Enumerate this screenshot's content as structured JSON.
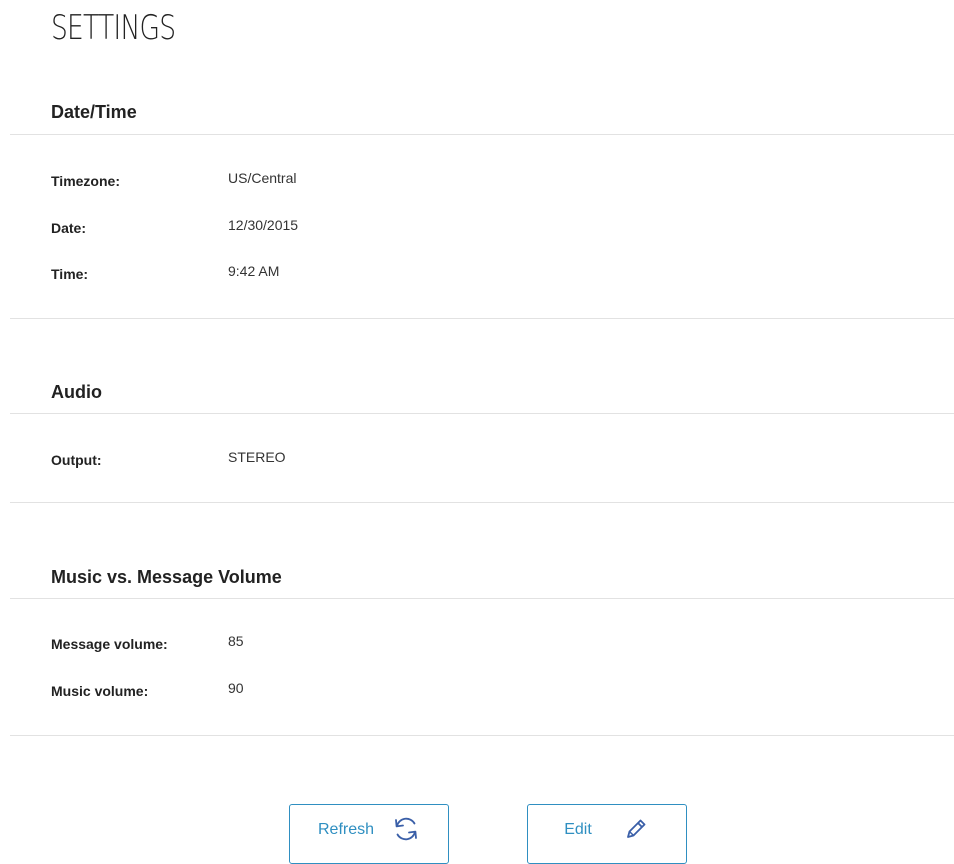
{
  "page": {
    "title": "SETTINGS"
  },
  "sections": {
    "datetime": {
      "title": "Date/Time",
      "rows": [
        {
          "label": "Timezone:",
          "value": "US/Central"
        },
        {
          "label": "Date:",
          "value": "12/30/2015"
        },
        {
          "label": "Time:",
          "value": "9:42 AM"
        }
      ]
    },
    "audio": {
      "title": "Audio",
      "rows": [
        {
          "label": "Output:",
          "value": "STEREO"
        }
      ]
    },
    "volume": {
      "title": "Music vs. Message Volume",
      "rows": [
        {
          "label": "Message volume:",
          "value": "85"
        },
        {
          "label": "Music volume:",
          "value": "90"
        }
      ]
    }
  },
  "actions": {
    "refresh": {
      "label": "Refresh",
      "icon": "refresh-icon"
    },
    "edit": {
      "label": "Edit",
      "icon": "pencil-icon"
    }
  },
  "colors": {
    "accent": "#2f8fc1",
    "icon": "#3a5fa8",
    "divider": "#e2e2e2",
    "text": "#222222"
  }
}
